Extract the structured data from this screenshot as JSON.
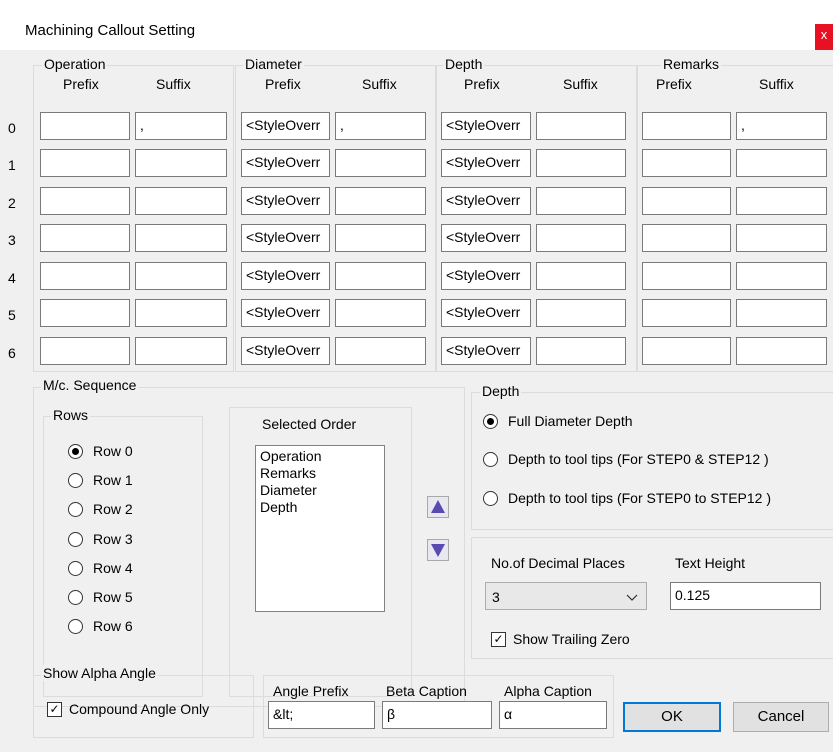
{
  "window": {
    "title": "Machining Callout Setting",
    "close_glyph": "x"
  },
  "groups": [
    {
      "label": "Operation",
      "prefix_header": "Prefix",
      "suffix_header": "Suffix",
      "prefix": [
        "",
        "",
        "",
        "",
        "",
        "",
        ""
      ],
      "suffix": [
        ",",
        "",
        "",
        "",
        "",
        "",
        ""
      ]
    },
    {
      "label": "Diameter",
      "prefix_header": "Prefix",
      "suffix_header": "Suffix",
      "prefix": [
        "<StyleOverr",
        "<StyleOverr",
        "<StyleOverr",
        "<StyleOverr",
        "<StyleOverr",
        "<StyleOverr",
        "<StyleOverr"
      ],
      "suffix": [
        ",",
        "",
        "",
        "",
        "",
        "",
        ""
      ]
    },
    {
      "label": "Depth",
      "prefix_header": "Prefix",
      "suffix_header": "Suffix",
      "prefix": [
        "<StyleOverr",
        "<StyleOverr",
        "<StyleOverr",
        "<StyleOverr",
        "<StyleOverr",
        "<StyleOverr",
        "<StyleOverr"
      ],
      "suffix": [
        "",
        "",
        "",
        "",
        "",
        "",
        ""
      ]
    },
    {
      "label": "Remarks",
      "prefix_header": "Prefix",
      "suffix_header": "Suffix",
      "prefix": [
        "",
        "",
        "",
        "",
        "",
        "",
        ""
      ],
      "suffix": [
        ",",
        "",
        "",
        "",
        "",
        "",
        ""
      ]
    }
  ],
  "row_numbers": [
    "0",
    "1",
    "2",
    "3",
    "4",
    "5",
    "6"
  ],
  "sequence": {
    "label": "M/c. Sequence",
    "rows_label": "Rows",
    "rows": [
      {
        "label": "Row 0",
        "selected": true
      },
      {
        "label": "Row 1",
        "selected": false
      },
      {
        "label": "Row 2",
        "selected": false
      },
      {
        "label": "Row 3",
        "selected": false
      },
      {
        "label": "Row 4",
        "selected": false
      },
      {
        "label": "Row 5",
        "selected": false
      },
      {
        "label": "Row 6",
        "selected": false
      }
    ],
    "order_label": "Selected Order",
    "order": [
      "Operation",
      "Remarks",
      "Diameter",
      "Depth"
    ]
  },
  "depth_option": {
    "label": "Depth",
    "options": [
      {
        "label": "Full Diameter Depth",
        "selected": true
      },
      {
        "label": "Depth to tool tips (For STEP0 & STEP12 )",
        "selected": false
      },
      {
        "label": "Depth to tool tips (For STEP0 to STEP12 )",
        "selected": false
      }
    ]
  },
  "decimal": {
    "label": "No.of Decimal Places",
    "value": "3"
  },
  "text_height": {
    "label": "Text Height",
    "value": "0.125"
  },
  "trailing_zero": {
    "label": "Show Trailing Zero",
    "checked": true
  },
  "alpha_angle": {
    "label": "Show Alpha Angle",
    "checkbox_label": "Compound Angle Only",
    "checked": true
  },
  "captions": {
    "angle_prefix_label": "Angle Prefix",
    "angle_prefix": "&lt;",
    "beta_label": "Beta Caption",
    "beta": "β",
    "alpha_label": "Alpha Caption",
    "alpha": "α"
  },
  "buttons": {
    "ok": "OK",
    "cancel": "Cancel"
  },
  "colors": {
    "close": "#e81123",
    "accent": "#0078d7",
    "arrow": "#5a4ab0"
  }
}
